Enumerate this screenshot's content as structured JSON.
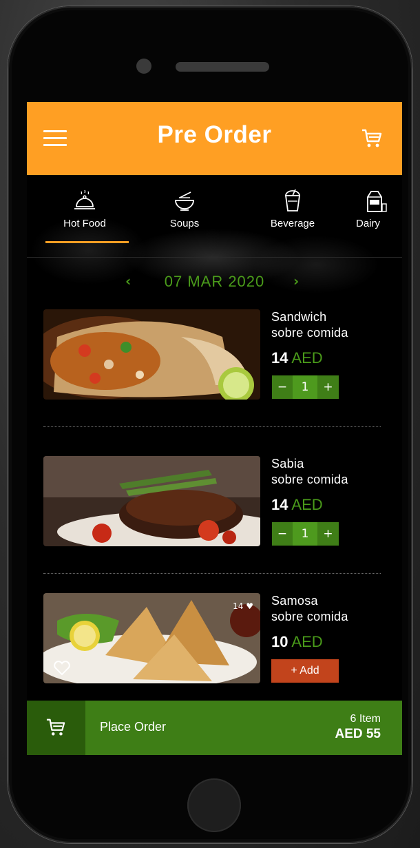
{
  "app": {
    "title": "Pre Order"
  },
  "categories": [
    {
      "label": "Hot Food",
      "icon": "cloche-icon",
      "active": true
    },
    {
      "label": "Soups",
      "icon": "soup-bowl-icon",
      "active": false
    },
    {
      "label": "Beverage",
      "icon": "beverage-cup-icon",
      "active": false
    },
    {
      "label": "Dairy",
      "icon": "milk-carton-icon",
      "active": false
    }
  ],
  "date": {
    "label": "07 MAR 2020",
    "prev": "‹",
    "next": "›"
  },
  "items": [
    {
      "name_line1": "Sandwich",
      "name_line2": "sobre comida",
      "price": "14",
      "currency": "AED",
      "qty": "1",
      "minus": "−",
      "plus": "+"
    },
    {
      "name_line1": "Sabia",
      "name_line2": "sobre comida",
      "price": "14",
      "currency": "AED",
      "qty": "1",
      "minus": "−",
      "plus": "+"
    },
    {
      "name_line1": "Samosa",
      "name_line2": "sobre comida",
      "price": "10",
      "currency": "AED",
      "add_label": "+ Add",
      "likes": "14"
    }
  ],
  "footer": {
    "place_order": "Place Order",
    "item_count": "6 Item",
    "total": "AED 55"
  },
  "colors": {
    "accent": "#ff9f23",
    "green": "#4a9b1a",
    "bar_green": "#3e7e16",
    "add": "#c2441c"
  }
}
